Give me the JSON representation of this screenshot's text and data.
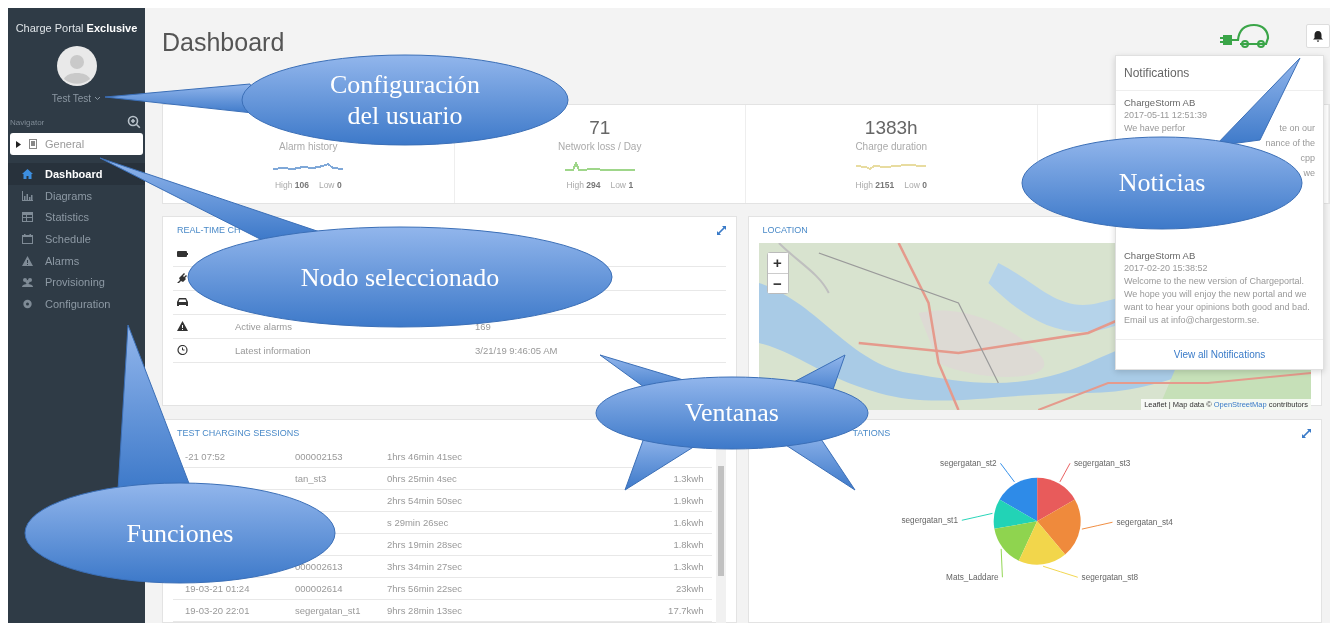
{
  "sidebar": {
    "brand": "Charge Portal **Exclusive**",
    "user": "Test Test",
    "navigator_label": "Navigator",
    "node": {
      "label": "General",
      "expanded": false
    },
    "menu": [
      {
        "label": "Dashboard",
        "kind": "home",
        "selected": true
      },
      {
        "label": "Diagrams",
        "kind": "chart",
        "selected": false
      },
      {
        "label": "Statistics",
        "kind": "table",
        "selected": false
      },
      {
        "label": "Schedule",
        "kind": "calendar",
        "selected": false
      },
      {
        "label": "Alarms",
        "kind": "warning",
        "selected": false
      },
      {
        "label": "Provisioning",
        "kind": "users",
        "selected": false
      },
      {
        "label": "Configuration",
        "kind": "gear",
        "selected": false
      }
    ]
  },
  "header": {
    "title": "Dashboard"
  },
  "stats": [
    {
      "label": "Alarm history",
      "high": "High **106**",
      "low": "Low **0**",
      "color": "#7fa8d8"
    },
    {
      "value": "71",
      "label": "Network loss / Day",
      "high": "High **294**",
      "low": "Low **1**",
      "color": "#9fd68a"
    },
    {
      "value": "1383h",
      "label": "Charge duration",
      "high": "High **2151**",
      "low": "Low **0**",
      "color": "#e8dca0"
    }
  ],
  "realtime": {
    "title": "REAL-TIME CH",
    "rows": [
      {
        "kind": "battery"
      },
      {
        "kind": "plug"
      },
      {
        "kind": "car"
      },
      {
        "kind": "warning",
        "label": "Active alarms",
        "value": "169"
      },
      {
        "kind": "clock",
        "label": "Latest information",
        "value": "3/21/19 9:46:05 AM"
      }
    ]
  },
  "location": {
    "title": "LOCATION",
    "zoom_in": "+",
    "zoom_out": "−",
    "attribution": "Leaflet | Map data © ",
    "attribution_link": "OpenStreetMap",
    "attribution_end": " contributors"
  },
  "sessions": {
    "title": "TEST CHARGING SESSIONS",
    "rows": [
      {
        "date": "-21 07:52",
        "id": "000002153",
        "duration": "1hrs 46min 41sec"
      },
      {
        "id": "tan_st3",
        "duration": "0hrs 25min 4sec",
        "energy": "1.3kwh"
      },
      {
        "duration": "2hrs 54min 50sec",
        "energy": "1.9kwh"
      },
      {
        "duration": "s 29min 26sec",
        "energy": "1.6kwh"
      },
      {
        "duration": "2hrs 19min 28sec",
        "energy": "1.8kwh"
      },
      {
        "id": "000002613",
        "duration": "3hrs 34min 27sec",
        "energy": "1.3kwh"
      },
      {
        "date": "19-03-21 01:24",
        "id": "000002614",
        "duration": "7hrs 56min 22sec",
        "energy": "23kwh"
      },
      {
        "date": "19-03-20 22:01",
        "id": "segergatan_st1",
        "duration": "9hrs 28min 13sec",
        "energy": "17.7kwh"
      }
    ]
  },
  "stations": {
    "title": "TATIONS",
    "slices": [
      {
        "label": "segergatan_st2",
        "color": "#2e8be8"
      },
      {
        "label": "segergatan_st3",
        "color": "#e85b5b"
      },
      {
        "label": "segergatan_st1",
        "color": "#22d3b6"
      },
      {
        "label": "segergatan_st4",
        "color": "#ef8a3c"
      },
      {
        "label": "Mats_Laddare",
        "color": "#8fd44f"
      },
      {
        "label": "segergatan_st8",
        "color": "#f2d64b"
      }
    ]
  },
  "notifications": {
    "title": "Notifications",
    "items": [
      {
        "sender": "ChargeStorm AB",
        "time": "2017-05-11 12:51:39",
        "fragments": [
          {
            "left": "We have perfor",
            "right": "te on our"
          },
          {
            "right": "nance of the"
          },
          {
            "right": "cpp"
          },
          {
            "right": "we"
          }
        ]
      },
      {
        "sender": "ChargeStorm AB",
        "time": "2017-02-20 15:38:52",
        "body": "Welcome to the new version of Chargeportal. We hope you will enjoy the new portal and we want to hear your opinions both good and bad. Email us at info@chargestorm.se."
      }
    ],
    "footer": "View all Notifications"
  },
  "callouts": [
    {
      "lines": [
        "Configuración",
        "del usuario"
      ]
    },
    {
      "lines": [
        "Nodo seleccionado"
      ]
    },
    {
      "lines": [
        "Noticias"
      ]
    },
    {
      "lines": [
        "Ventanas"
      ]
    },
    {
      "lines": [
        "Funciones"
      ]
    }
  ]
}
